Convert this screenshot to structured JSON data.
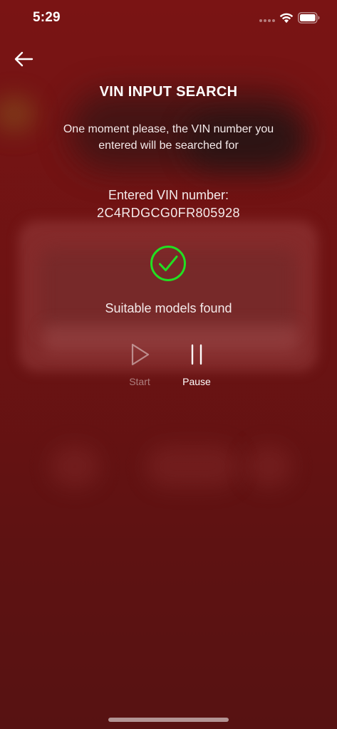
{
  "status_bar": {
    "time": "5:29",
    "icons": [
      "cellular-dots-icon",
      "wifi-icon",
      "battery-icon"
    ]
  },
  "header": {
    "back_icon": "arrow-left-icon",
    "title": "VIN INPUT SEARCH"
  },
  "main": {
    "message": "One moment please, the VIN number you entered will be searched for",
    "vin_label": "Entered VIN number:",
    "vin_value": "2C4RDGCG0FR805928",
    "status_icon": "check-circle-icon",
    "result_text": "Suitable models found"
  },
  "controls": {
    "start": {
      "label": "Start",
      "icon": "play-icon",
      "enabled": false
    },
    "pause": {
      "label": "Pause",
      "icon": "pause-icon",
      "enabled": true
    }
  },
  "colors": {
    "background": "#6c1313",
    "success": "#22e022",
    "text": "#ffffff"
  }
}
